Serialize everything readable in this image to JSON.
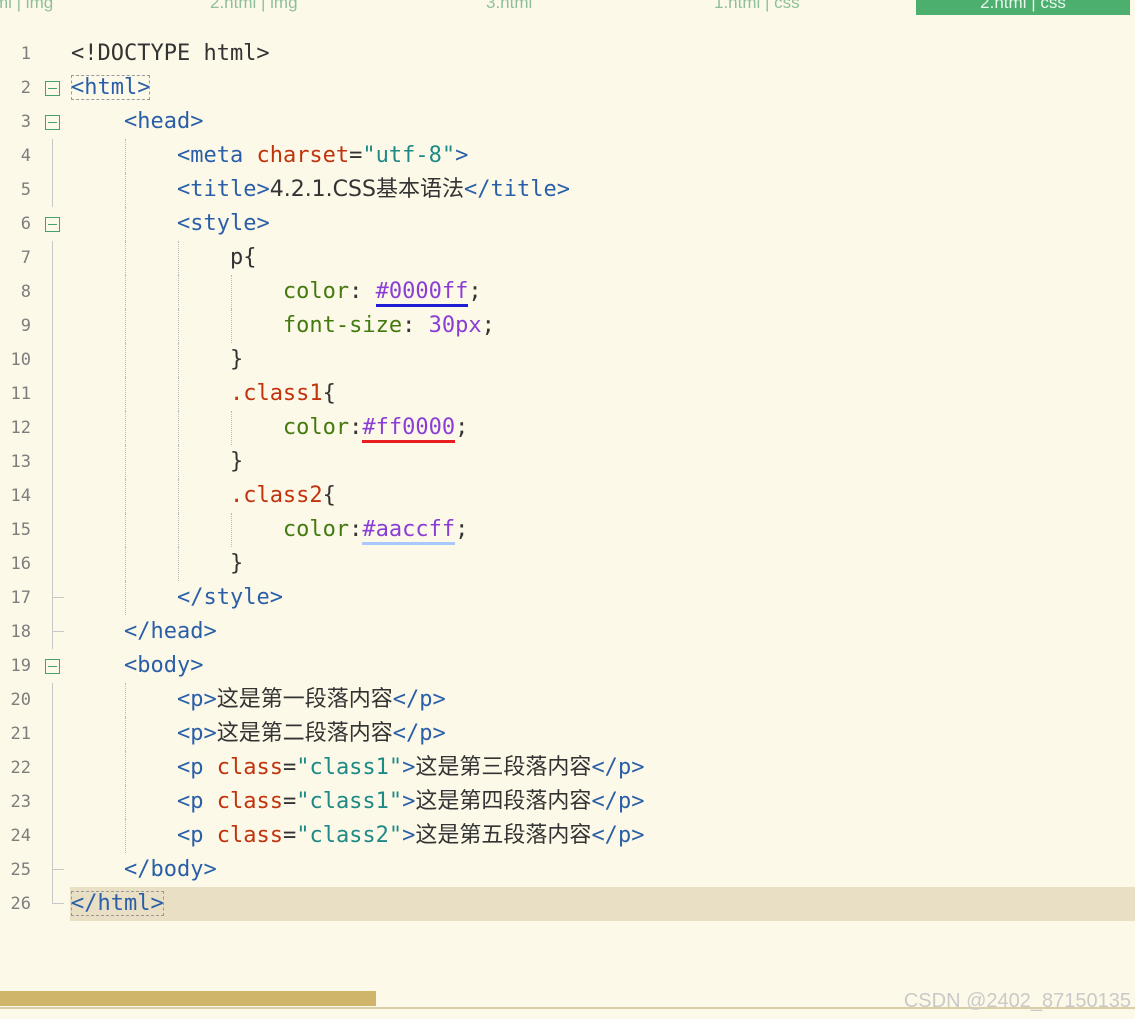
{
  "tabs": [
    {
      "label": "ml | img"
    },
    {
      "label": "2.html | img"
    },
    {
      "label": "3.html"
    },
    {
      "label": "1.html | css"
    },
    {
      "label": "2.html | css"
    }
  ],
  "lines": [
    {
      "n": "1"
    },
    {
      "n": "2"
    },
    {
      "n": "3"
    },
    {
      "n": "4"
    },
    {
      "n": "5"
    },
    {
      "n": "6"
    },
    {
      "n": "7"
    },
    {
      "n": "8"
    },
    {
      "n": "9"
    },
    {
      "n": "10"
    },
    {
      "n": "11"
    },
    {
      "n": "12"
    },
    {
      "n": "13"
    },
    {
      "n": "14"
    },
    {
      "n": "15"
    },
    {
      "n": "16"
    },
    {
      "n": "17"
    },
    {
      "n": "18"
    },
    {
      "n": "19"
    },
    {
      "n": "20"
    },
    {
      "n": "21"
    },
    {
      "n": "22"
    },
    {
      "n": "23"
    },
    {
      "n": "24"
    },
    {
      "n": "25"
    },
    {
      "n": "26"
    }
  ],
  "code": {
    "l1": "<!DOCTYPE html>",
    "l2": "html",
    "l3": "head",
    "l4_tag": "meta",
    "l4_attr": "charset",
    "l4_val": "\"utf-8\"",
    "l5_tag": "title",
    "l5_text": "4.2.1.CSS基本语法",
    "l6": "style",
    "l7": "p",
    "l8_prop": "color",
    "l8_val": "#0000ff",
    "l9_prop": "font-size",
    "l9_val": "30px",
    "l11": ".class1",
    "l12_prop": "color",
    "l12_val": "#ff0000",
    "l14": ".class2",
    "l15_prop": "color",
    "l15_val": "#aaccff",
    "l17": "style",
    "l18": "head",
    "l19": "body",
    "p": "p",
    "class_attr": "class",
    "class1_val": "\"class1\"",
    "class2_val": "\"class2\"",
    "l20_text": "这是第一段落内容",
    "l21_text": "这是第二段落内容",
    "l22_text": "这是第三段落内容",
    "l23_text": "这是第四段落内容",
    "l24_text": "这是第五段落内容",
    "l25": "body",
    "l26": "html"
  },
  "colors": {
    "background": "#fdf9e8",
    "active_tab": "#4caf6e",
    "current_line": "#e8dfc4",
    "tag": "#2a5fa8",
    "attribute": "#c0330d",
    "string": "#1d8a86",
    "property": "#437a10",
    "value": "#8a3ed6"
  },
  "watermark": "CSDN @2402_87150135"
}
